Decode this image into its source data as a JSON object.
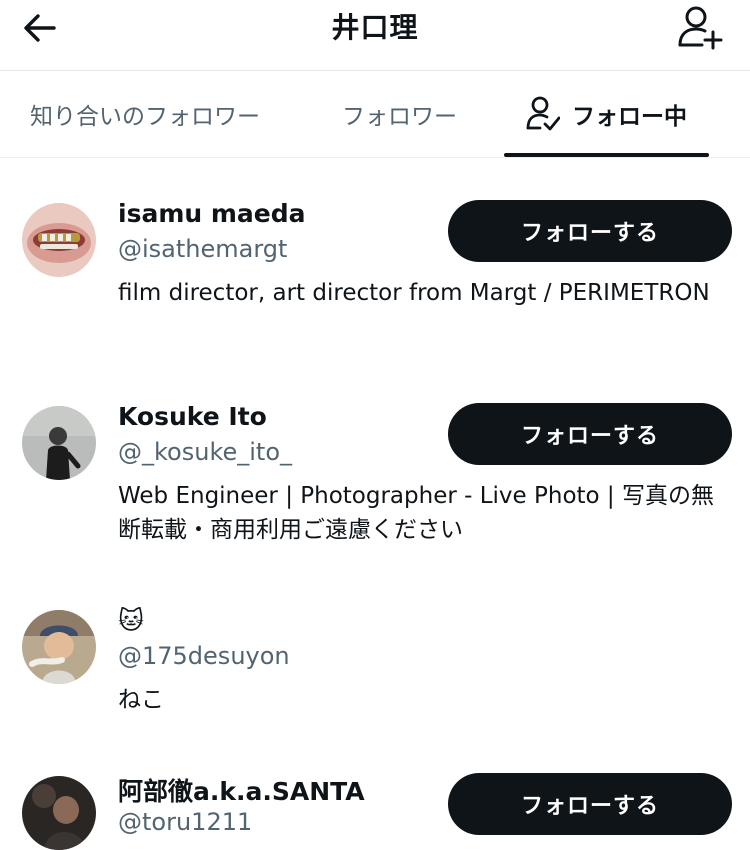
{
  "header": {
    "title": "井口理",
    "back_icon": "arrow-left-icon",
    "add_user_icon": "person-plus-icon"
  },
  "tabs": [
    {
      "label": "知り合いのフォロワー",
      "active": false
    },
    {
      "label": "フォロワー",
      "active": false
    },
    {
      "label": "フォロー中",
      "active": true,
      "icon": "person-check-icon"
    }
  ],
  "users": [
    {
      "name": "isamu maeda",
      "handle": "@isathemargt",
      "bio": "film director, art director from Margt / PERIMETRON",
      "follow_label": "フォローする"
    },
    {
      "name": "Kosuke Ito",
      "handle": "@_kosuke_ito_",
      "bio": "Web Engineer | Photographer - Live Photo | 写真の無断転載・商用利用ご遠慮ください",
      "follow_label": "フォローする"
    },
    {
      "name": "🐱",
      "handle": "@175desuyon",
      "bio": "ねこ"
    },
    {
      "name": "阿部徹a.k.a.SANTA",
      "handle": "@toru1211",
      "follow_label": "フォローする"
    }
  ],
  "colors": {
    "primary_text": "#0f1419",
    "secondary_text": "#536471",
    "button_bg": "#0f1419",
    "button_text": "#ffffff",
    "divider": "#e6e8ea"
  }
}
